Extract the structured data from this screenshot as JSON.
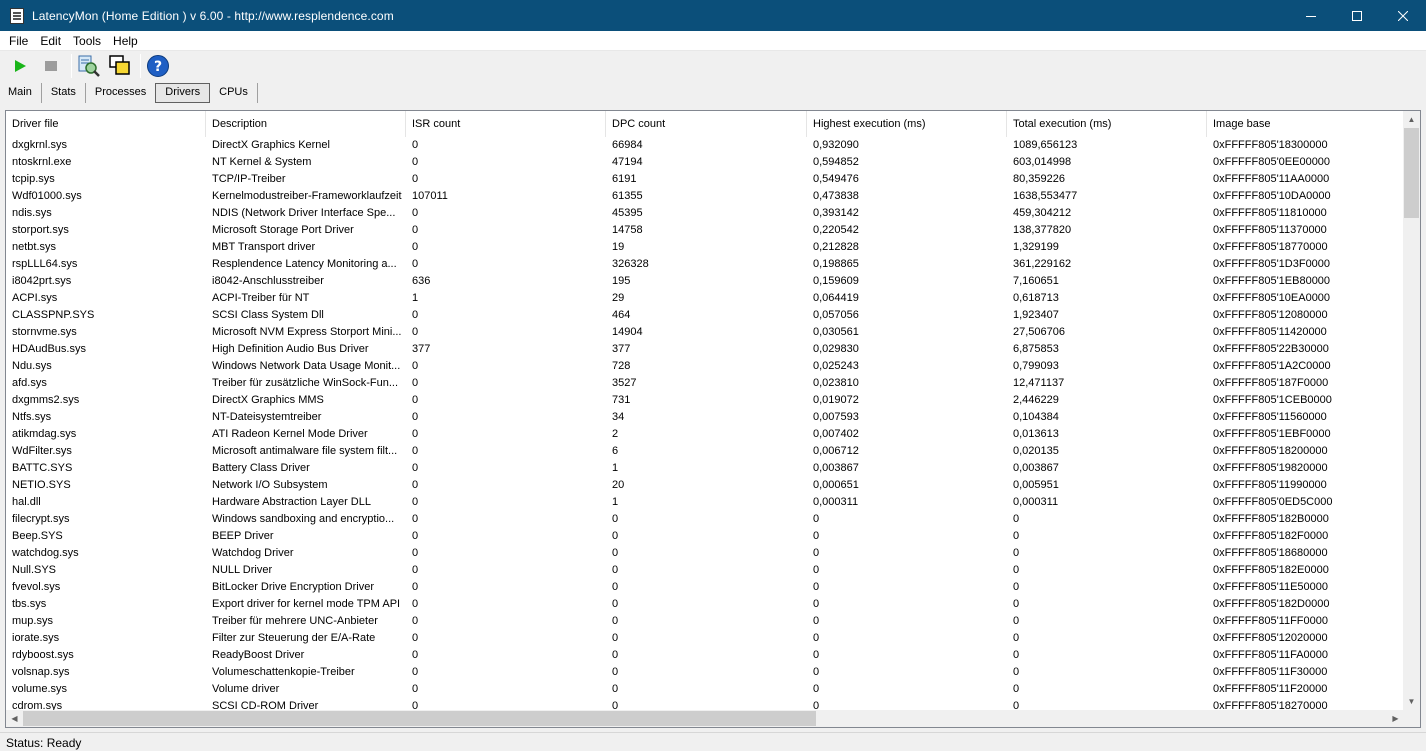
{
  "window": {
    "title": "LatencyMon  (Home Edition )  v 6.00 - http://www.resplendence.com"
  },
  "menu": [
    "File",
    "Edit",
    "Tools",
    "Help"
  ],
  "toolbar": {
    "icons": [
      "play-icon",
      "stop-icon",
      "reporting-icon",
      "windows-icon",
      "help-icon"
    ]
  },
  "tabs": [
    {
      "label": "Main",
      "active": false
    },
    {
      "label": "Stats",
      "active": false
    },
    {
      "label": "Processes",
      "active": false
    },
    {
      "label": "Drivers",
      "active": true
    },
    {
      "label": "CPUs",
      "active": false
    }
  ],
  "table": {
    "columns": [
      "Driver file",
      "Description",
      "ISR count",
      "DPC count",
      "Highest execution (ms)",
      "Total execution (ms)",
      "Image base"
    ],
    "rows": [
      [
        "dxgkrnl.sys",
        "DirectX Graphics Kernel",
        "0",
        "66984",
        "0,932090",
        "1089,656123",
        "0xFFFFF805'18300000"
      ],
      [
        "ntoskrnl.exe",
        "NT Kernel & System",
        "0",
        "47194",
        "0,594852",
        "603,014998",
        "0xFFFFF805'0EE00000"
      ],
      [
        "tcpip.sys",
        "TCP/IP-Treiber",
        "0",
        "6191",
        "0,549476",
        "80,359226",
        "0xFFFFF805'11AA0000"
      ],
      [
        "Wdf01000.sys",
        "Kernelmodustreiber-Frameworklaufzeit",
        "107011",
        "61355",
        "0,473838",
        "1638,553477",
        "0xFFFFF805'10DA0000"
      ],
      [
        "ndis.sys",
        "NDIS (Network Driver Interface Spe...",
        "0",
        "45395",
        "0,393142",
        "459,304212",
        "0xFFFFF805'11810000"
      ],
      [
        "storport.sys",
        "Microsoft Storage Port Driver",
        "0",
        "14758",
        "0,220542",
        "138,377820",
        "0xFFFFF805'11370000"
      ],
      [
        "netbt.sys",
        "MBT Transport driver",
        "0",
        "19",
        "0,212828",
        "1,329199",
        "0xFFFFF805'18770000"
      ],
      [
        "rspLLL64.sys",
        "Resplendence Latency Monitoring a...",
        "0",
        "326328",
        "0,198865",
        "361,229162",
        "0xFFFFF805'1D3F0000"
      ],
      [
        "i8042prt.sys",
        "i8042-Anschlusstreiber",
        "636",
        "195",
        "0,159609",
        "7,160651",
        "0xFFFFF805'1EB80000"
      ],
      [
        "ACPI.sys",
        "ACPI-Treiber für NT",
        "1",
        "29",
        "0,064419",
        "0,618713",
        "0xFFFFF805'10EA0000"
      ],
      [
        "CLASSPNP.SYS",
        "SCSI Class System Dll",
        "0",
        "464",
        "0,057056",
        "1,923407",
        "0xFFFFF805'12080000"
      ],
      [
        "stornvme.sys",
        "Microsoft NVM Express Storport Mini...",
        "0",
        "14904",
        "0,030561",
        "27,506706",
        "0xFFFFF805'11420000"
      ],
      [
        "HDAudBus.sys",
        "High Definition Audio Bus Driver",
        "377",
        "377",
        "0,029830",
        "6,875853",
        "0xFFFFF805'22B30000"
      ],
      [
        "Ndu.sys",
        "Windows Network Data Usage Monit...",
        "0",
        "728",
        "0,025243",
        "0,799093",
        "0xFFFFF805'1A2C0000"
      ],
      [
        "afd.sys",
        "Treiber für zusätzliche WinSock-Fun...",
        "0",
        "3527",
        "0,023810",
        "12,471137",
        "0xFFFFF805'187F0000"
      ],
      [
        "dxgmms2.sys",
        "DirectX Graphics MMS",
        "0",
        "731",
        "0,019072",
        "2,446229",
        "0xFFFFF805'1CEB0000"
      ],
      [
        "Ntfs.sys",
        "NT-Dateisystemtreiber",
        "0",
        "34",
        "0,007593",
        "0,104384",
        "0xFFFFF805'11560000"
      ],
      [
        "atikmdag.sys",
        "ATI Radeon Kernel Mode Driver",
        "0",
        "2",
        "0,007402",
        "0,013613",
        "0xFFFFF805'1EBF0000"
      ],
      [
        "WdFilter.sys",
        "Microsoft antimalware file system filt...",
        "0",
        "6",
        "0,006712",
        "0,020135",
        "0xFFFFF805'18200000"
      ],
      [
        "BATTC.SYS",
        "Battery Class Driver",
        "0",
        "1",
        "0,003867",
        "0,003867",
        "0xFFFFF805'19820000"
      ],
      [
        "NETIO.SYS",
        "Network I/O Subsystem",
        "0",
        "20",
        "0,000651",
        "0,005951",
        "0xFFFFF805'11990000"
      ],
      [
        "hal.dll",
        "Hardware Abstraction Layer DLL",
        "0",
        "1",
        "0,000311",
        "0,000311",
        "0xFFFFF805'0ED5C000"
      ],
      [
        "filecrypt.sys",
        "Windows sandboxing and encryptio...",
        "0",
        "0",
        "0",
        "0",
        "0xFFFFF805'182B0000"
      ],
      [
        "Beep.SYS",
        "BEEP Driver",
        "0",
        "0",
        "0",
        "0",
        "0xFFFFF805'182F0000"
      ],
      [
        "watchdog.sys",
        "Watchdog Driver",
        "0",
        "0",
        "0",
        "0",
        "0xFFFFF805'18680000"
      ],
      [
        "Null.SYS",
        "NULL Driver",
        "0",
        "0",
        "0",
        "0",
        "0xFFFFF805'182E0000"
      ],
      [
        "fvevol.sys",
        "BitLocker Drive Encryption Driver",
        "0",
        "0",
        "0",
        "0",
        "0xFFFFF805'11E50000"
      ],
      [
        "tbs.sys",
        "Export driver for kernel mode TPM API",
        "0",
        "0",
        "0",
        "0",
        "0xFFFFF805'182D0000"
      ],
      [
        "mup.sys",
        "Treiber für mehrere UNC-Anbieter",
        "0",
        "0",
        "0",
        "0",
        "0xFFFFF805'11FF0000"
      ],
      [
        "iorate.sys",
        "Filter zur Steuerung der E/A-Rate",
        "0",
        "0",
        "0",
        "0",
        "0xFFFFF805'12020000"
      ],
      [
        "rdyboost.sys",
        "ReadyBoost Driver",
        "0",
        "0",
        "0",
        "0",
        "0xFFFFF805'11FA0000"
      ],
      [
        "volsnap.sys",
        "Volumeschattenkopie-Treiber",
        "0",
        "0",
        "0",
        "0",
        "0xFFFFF805'11F30000"
      ],
      [
        "volume.sys",
        "Volume driver",
        "0",
        "0",
        "0",
        "0",
        "0xFFFFF805'11F20000"
      ],
      [
        "cdrom.sys",
        "SCSI CD-ROM Driver",
        "0",
        "0",
        "0",
        "0",
        "0xFFFFF805'18270000"
      ]
    ]
  },
  "status": "Status: Ready"
}
